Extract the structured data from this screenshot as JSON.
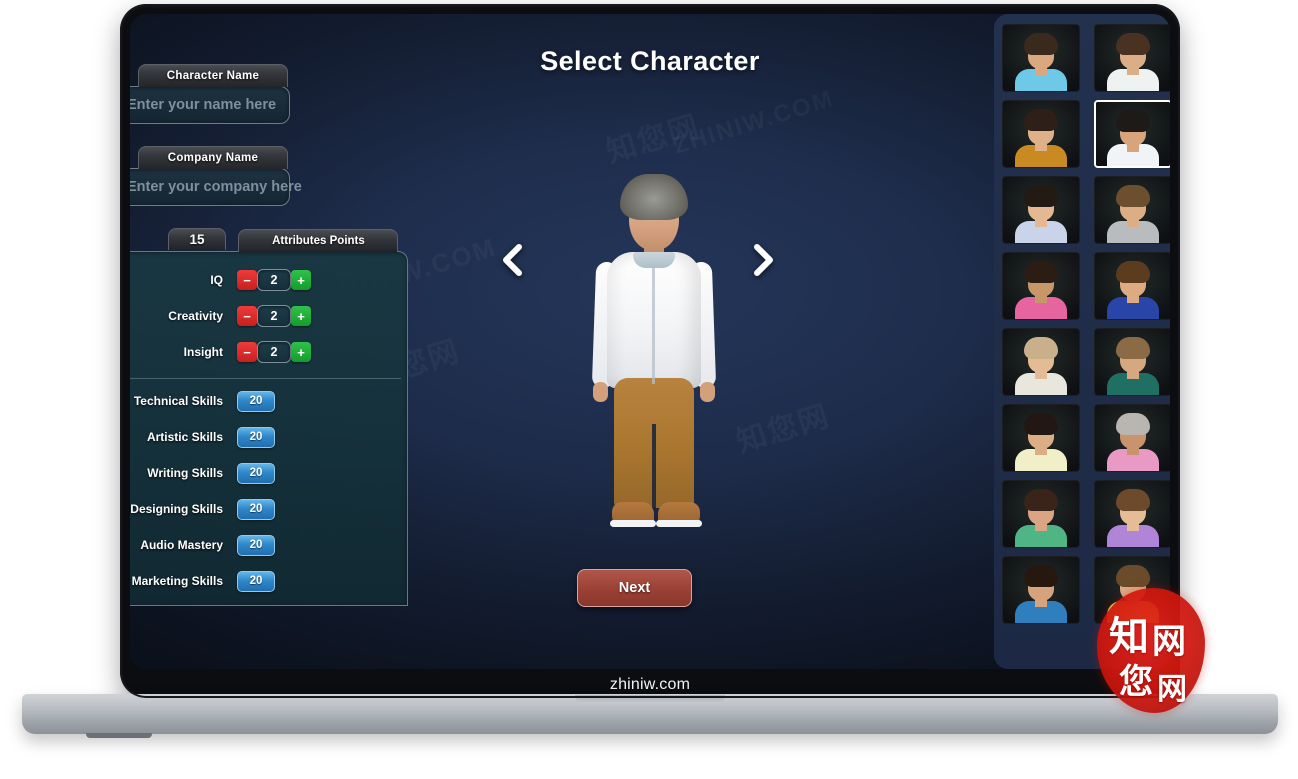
{
  "screen": {
    "title": "Select Character",
    "watermarks": [
      "ZHINIW.COM",
      "ZHINIW.COM",
      "ZHINIW.COM",
      "知您网",
      "知您网",
      "知您网"
    ],
    "nav": {
      "prev_icon": "chevron-left-icon",
      "next_icon": "chevron-right-icon"
    },
    "next_button": "Next"
  },
  "form": {
    "character_name": {
      "label": "Character Name",
      "placeholder": "Enter your name here",
      "value": ""
    },
    "company_name": {
      "label": "Company Name",
      "placeholder": "Enter your company here",
      "value": ""
    }
  },
  "attributes": {
    "points_value": "15",
    "points_label": "Attributes Points",
    "rows": [
      {
        "name": "IQ",
        "value": "2",
        "minus": "−",
        "plus": "+"
      },
      {
        "name": "Creativity",
        "value": "2",
        "minus": "−",
        "plus": "+"
      },
      {
        "name": "Insight",
        "value": "2",
        "minus": "−",
        "plus": "+"
      }
    ]
  },
  "skills": {
    "rows": [
      {
        "name": "Technical Skills",
        "value": "20"
      },
      {
        "name": "Artistic Skills",
        "value": "20"
      },
      {
        "name": "Writing Skills",
        "value": "20"
      },
      {
        "name": "Designing Skills",
        "value": "20"
      },
      {
        "name": "Audio Mastery",
        "value": "20"
      },
      {
        "name": "Marketing Skills",
        "value": "20"
      }
    ]
  },
  "character_grid": {
    "selected_index": 3,
    "thumbs": [
      {
        "id": "char-1",
        "hair": "#3a2a1e",
        "skin": "#d9a87f",
        "shirt": "#6ec9e8",
        "selected": false
      },
      {
        "id": "char-2",
        "hair": "#4a3222",
        "skin": "#dcae86",
        "shirt": "#eef2f0",
        "selected": false
      },
      {
        "id": "char-3",
        "hair": "#2e2018",
        "skin": "#e0b189",
        "shirt": "#c98a22",
        "selected": false
      },
      {
        "id": "char-4",
        "hair": "#1e1a18",
        "skin": "#d7a47c",
        "shirt": "#f1f4f6",
        "selected": true
      },
      {
        "id": "char-5",
        "hair": "#241a14",
        "skin": "#e3b892",
        "shirt": "#c9d3ea",
        "selected": false
      },
      {
        "id": "char-6",
        "hair": "#6b4f2e",
        "skin": "#dcae86",
        "shirt": "#b9bcbe",
        "selected": false
      },
      {
        "id": "char-7",
        "hair": "#2b1d14",
        "skin": "#c79669",
        "shirt": "#e665a0",
        "selected": false
      },
      {
        "id": "char-8",
        "hair": "#5b3c1f",
        "skin": "#dcab81",
        "shirt": "#2a45a8",
        "selected": false
      },
      {
        "id": "char-9",
        "hair": "#c9b08a",
        "skin": "#e5bb95",
        "shirt": "#e8e6dd",
        "selected": false
      },
      {
        "id": "char-10",
        "hair": "#8a6b45",
        "skin": "#d6a87f",
        "shirt": "#1f6f63",
        "selected": false
      },
      {
        "id": "char-11",
        "hair": "#221712",
        "skin": "#dcae86",
        "shirt": "#f0efc8",
        "selected": false
      },
      {
        "id": "char-12",
        "hair": "#b9b6b2",
        "skin": "#c9946d",
        "shirt": "#e89ac4",
        "selected": false
      },
      {
        "id": "char-13",
        "hair": "#3a241a",
        "skin": "#dba583",
        "shirt": "#4fb584",
        "selected": false
      },
      {
        "id": "char-14",
        "hair": "#6e4a2c",
        "skin": "#e6bb97",
        "shirt": "#b084d6",
        "selected": false
      },
      {
        "id": "char-15",
        "hair": "#26180f",
        "skin": "#d6a37c",
        "shirt": "#2f7fbe",
        "selected": false
      },
      {
        "id": "char-16",
        "hair": "#6a4b2a",
        "skin": "#dcae86",
        "shirt": "#cdd94a",
        "selected": false
      }
    ]
  },
  "device": {
    "bottom_label": "zhiniw.com"
  },
  "seal": {
    "chars": [
      "知",
      "网",
      "您",
      "网"
    ]
  },
  "colors": {
    "accent_blue": "#2f87c9",
    "danger_red": "#c71f1f",
    "success_green": "#149c2c",
    "next_button": "#9d4236",
    "panel_teal": "#193842",
    "grid_bg": "#22314e"
  }
}
